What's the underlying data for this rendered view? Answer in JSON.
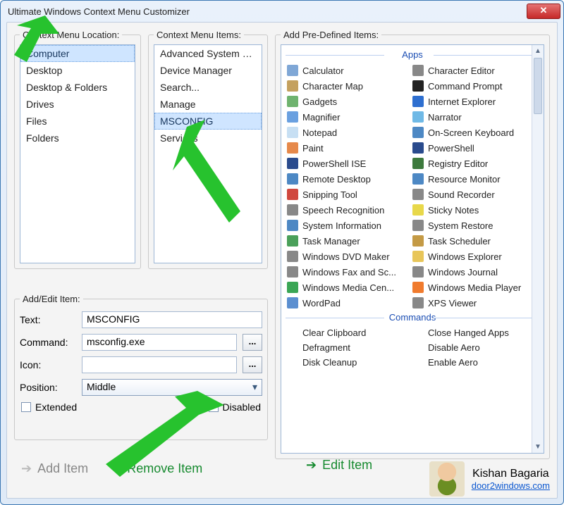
{
  "title": "Ultimate Windows Context Menu Customizer",
  "groups": {
    "location": "Context Menu Location:",
    "items": "Context Menu Items:",
    "predef": "Add Pre-Defined Items:",
    "edit": "Add/Edit Item:"
  },
  "location_list": [
    "Computer",
    "Desktop",
    "Desktop & Folders",
    "Drives",
    "Files",
    "Folders"
  ],
  "location_selected": 0,
  "items_list": [
    "Advanced System Pr...",
    "Device Manager",
    "Search...",
    "Manage",
    "MSCONFIG",
    "Services"
  ],
  "items_selected": 4,
  "predef": {
    "sections": [
      {
        "label": "Apps",
        "left": [
          "Calculator",
          "Character Map",
          "Gadgets",
          "Magnifier",
          "Notepad",
          "Paint",
          "PowerShell ISE",
          "Remote Desktop",
          "Snipping Tool",
          "Speech Recognition",
          "System Information",
          "Task Manager",
          "Windows DVD Maker",
          "Windows Fax and Sc...",
          "Windows Media Cen...",
          "WordPad"
        ],
        "right": [
          "Character Editor",
          "Command Prompt",
          "Internet Explorer",
          "Narrator",
          "On-Screen Keyboard",
          "PowerShell",
          "Registry Editor",
          "Resource Monitor",
          "Sound Recorder",
          "Sticky Notes",
          "System Restore",
          "Task Scheduler",
          "Windows Explorer",
          "Windows Journal",
          "Windows Media Player",
          "XPS Viewer"
        ]
      },
      {
        "label": "Commands",
        "left": [
          "Clear Clipboard",
          "Defragment",
          "Disk Cleanup"
        ],
        "right": [
          "Close Hanged Apps",
          "Disable Aero",
          "Enable Aero"
        ]
      }
    ]
  },
  "edit": {
    "labels": {
      "text": "Text:",
      "command": "Command:",
      "icon": "Icon:",
      "position": "Position:"
    },
    "text": "MSCONFIG",
    "command": "msconfig.exe",
    "icon": "",
    "position": "Middle",
    "extended_label": "Extended",
    "extended": false,
    "disabled_label": "Disabled",
    "disabled": true
  },
  "actions": {
    "add": "Add Item",
    "remove": "Remove Item",
    "edit": "Edit Item"
  },
  "credits": {
    "name": "Kishan Bagaria",
    "site": "door2windows.com"
  },
  "icon_colors": {
    "Calculator": "#7fa7d6",
    "Character Map": "#c4a15f",
    "Gadgets": "#6fb36f",
    "Magnifier": "#6aa0e0",
    "Notepad": "#c7dff3",
    "Paint": "#e6894b",
    "PowerShell ISE": "#2a4b8d",
    "Remote Desktop": "#4d88c4",
    "Snipping Tool": "#d0483f",
    "Speech Recognition": "#888",
    "System Information": "#4d88c4",
    "Task Manager": "#4aa05a",
    "Windows DVD Maker": "#888",
    "Windows Fax and Sc...": "#888",
    "Windows Media Cen...": "#3aa655",
    "WordPad": "#5b8fd0",
    "Character Editor": "#888",
    "Command Prompt": "#222",
    "Internet Explorer": "#2e6fd0",
    "Narrator": "#6fb9e6",
    "On-Screen Keyboard": "#4d88c4",
    "PowerShell": "#2a4b8d",
    "Registry Editor": "#3d7a3d",
    "Resource Monitor": "#4d88c4",
    "Sound Recorder": "#888",
    "Sticky Notes": "#e8d84a",
    "System Restore": "#888",
    "Task Scheduler": "#c49a45",
    "Windows Explorer": "#e8c65a",
    "Windows Journal": "#888",
    "Windows Media Player": "#f07b2e",
    "XPS Viewer": "#888",
    "Clear Clipboard": "",
    "Defragment": "",
    "Disk Cleanup": "",
    "Close Hanged Apps": "",
    "Disable Aero": "",
    "Enable Aero": ""
  }
}
